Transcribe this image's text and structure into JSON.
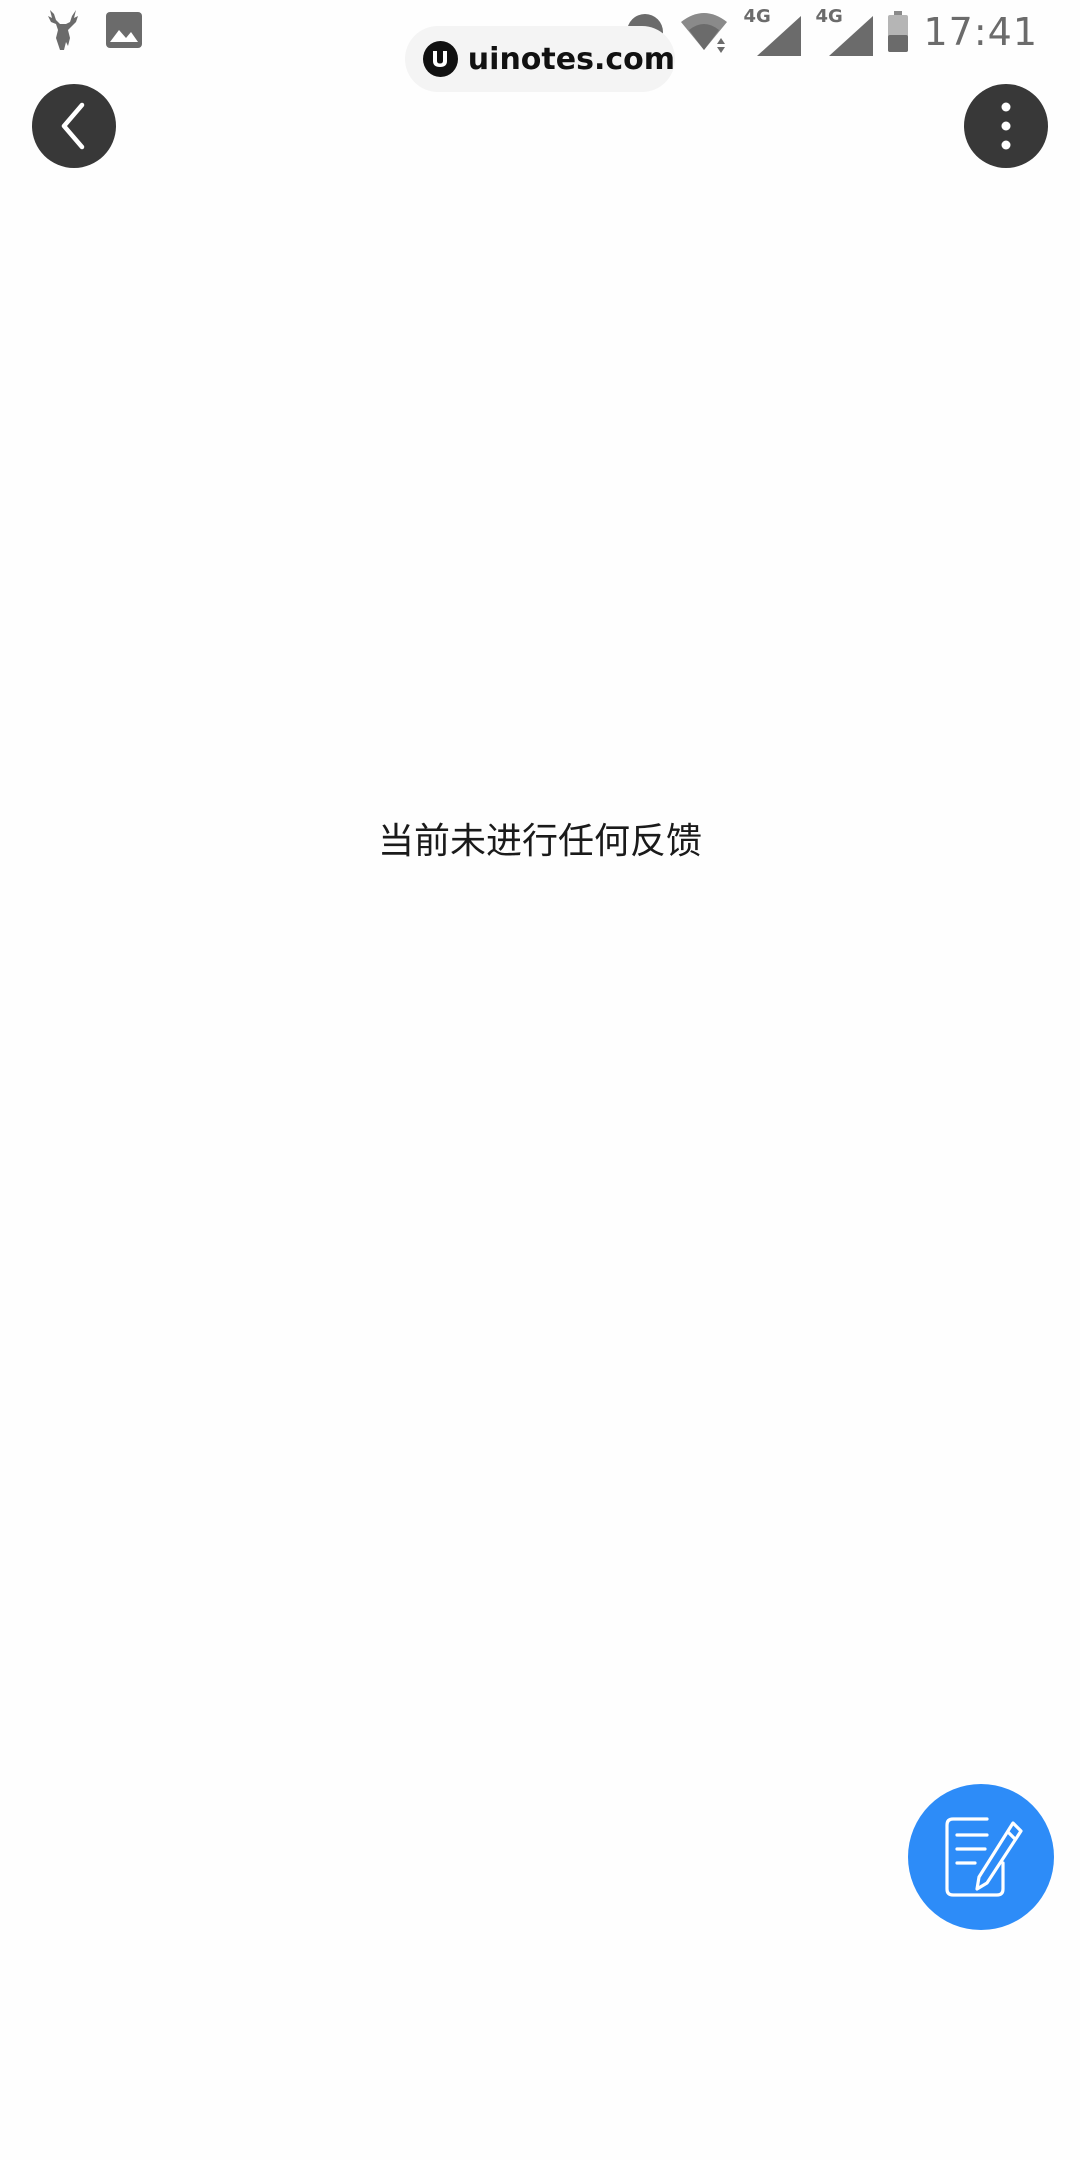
{
  "status_bar": {
    "time": "17:41",
    "network_1": "4G",
    "network_2": "4G",
    "icons": [
      "deer-app-icon",
      "gallery-icon",
      "dnd-icon",
      "wifi-icon",
      "signal-icon",
      "signal-icon",
      "battery-icon"
    ]
  },
  "watermark": {
    "text": "uinotes.com",
    "logo_letter": "U"
  },
  "header": {
    "back_icon": "chevron-left-icon",
    "more_icon": "more-vertical-icon"
  },
  "main": {
    "empty_message": "当前未进行任何反馈"
  },
  "fab": {
    "icon": "edit-note-icon"
  },
  "colors": {
    "fab": "#2d8cf8",
    "header_button": "#383838",
    "status_gray": "#6b6b6b",
    "text": "#1a1a1a",
    "background": "#fefefe"
  }
}
